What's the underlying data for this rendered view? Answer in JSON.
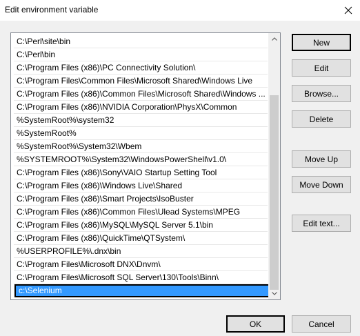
{
  "window": {
    "title": "Edit environment variable",
    "close_icon": "close-icon"
  },
  "path_list": {
    "items": [
      "C:\\Perl\\site\\bin",
      "C:\\Perl\\bin",
      "C:\\Program Files (x86)\\PC Connectivity Solution\\",
      "C:\\Program Files\\Common Files\\Microsoft Shared\\Windows Live",
      "C:\\Program Files (x86)\\Common Files\\Microsoft Shared\\Windows ...",
      "C:\\Program Files (x86)\\NVIDIA Corporation\\PhysX\\Common",
      "%SystemRoot%\\system32",
      "%SystemRoot%",
      "%SystemRoot%\\System32\\Wbem",
      "%SYSTEMROOT%\\System32\\WindowsPowerShell\\v1.0\\",
      "C:\\Program Files (x86)\\Sony\\VAIO Startup Setting Tool",
      "C:\\Program Files (x86)\\Windows Live\\Shared",
      "C:\\Program Files (x86)\\Smart Projects\\IsoBuster",
      "C:\\Program Files (x86)\\Common Files\\Ulead Systems\\MPEG",
      "C:\\Program Files (x86)\\MySQL\\MySQL Server 5.1\\bin",
      "C:\\Program Files (x86)\\QuickTime\\QTSystem\\",
      "%USERPROFILE%\\.dnx\\bin",
      "C:\\Program Files\\Microsoft DNX\\Dnvm\\",
      "C:\\Program Files\\Microsoft SQL Server\\130\\Tools\\Binn\\",
      "c:\\Selenium"
    ],
    "selected_index": 19
  },
  "buttons": {
    "new": "New",
    "edit": "Edit",
    "browse": "Browse...",
    "delete": "Delete",
    "move_up": "Move Up",
    "move_down": "Move Down",
    "edit_text": "Edit text...",
    "ok": "OK",
    "cancel": "Cancel"
  },
  "colors": {
    "selection": "#3399ff",
    "dialog_bg": "#f0f0f0",
    "button_bg": "#e1e1e1"
  }
}
